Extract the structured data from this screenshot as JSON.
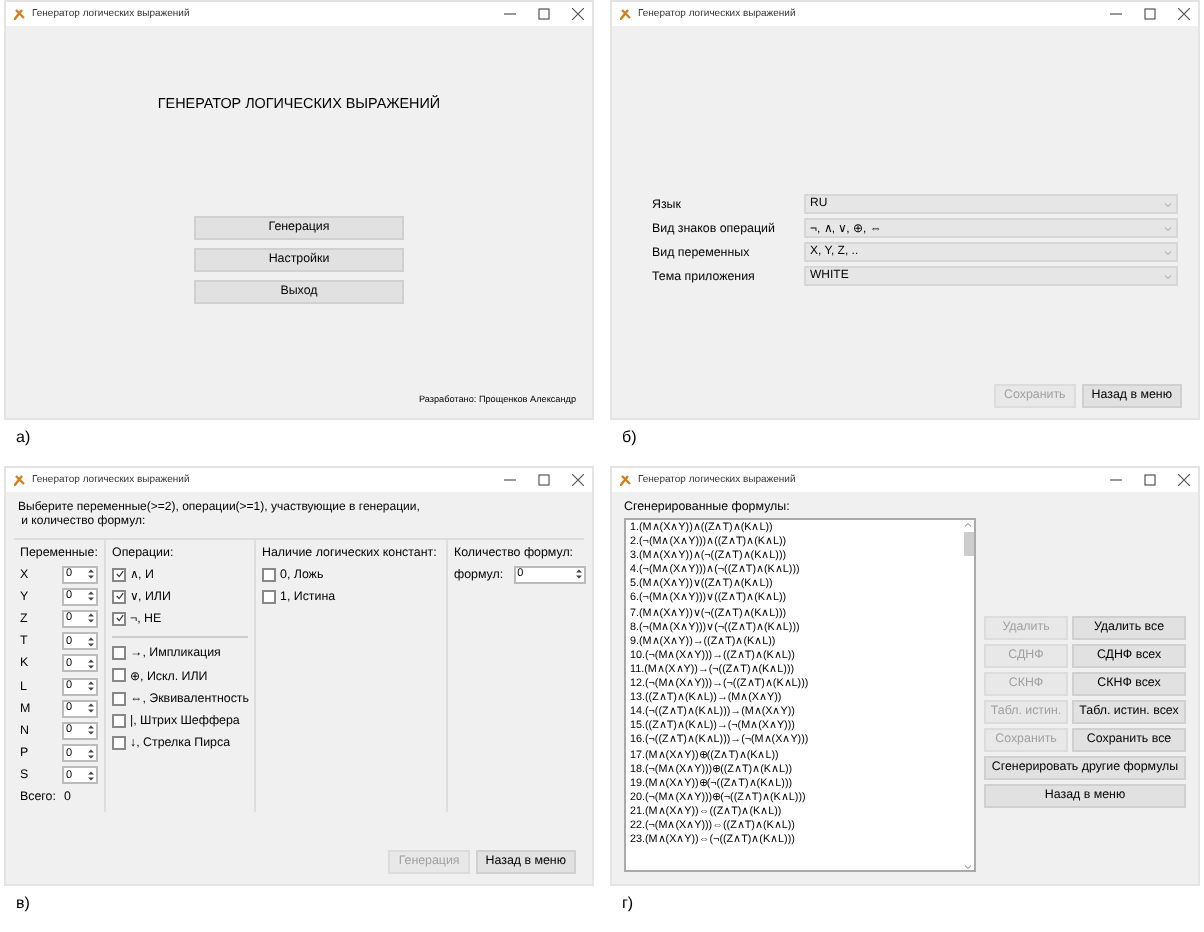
{
  "windows": [
    {
      "kind": "menu",
      "title": "Генератор логических выражений",
      "caption": "а)",
      "heading": "ГЕНЕРАТОР ЛОГИЧЕСКИХ ВЫРАЖЕНИЙ",
      "buttons": [
        {
          "label": "Генерация",
          "disabled": false
        },
        {
          "label": "Настройки",
          "disabled": false
        },
        {
          "label": "Выход",
          "disabled": false
        }
      ],
      "footer": "Разработано: Прощенков Александр"
    },
    {
      "kind": "settings",
      "title": "Генератор логических выражений",
      "caption": "б)",
      "fields": [
        {
          "label": "Язык",
          "value": "RU"
        },
        {
          "label": "Вид знаков операций",
          "value": "¬, ∧, ∨, ⊕, ⇔"
        },
        {
          "label": "Вид переменных",
          "value": "X, Y, Z, .."
        },
        {
          "label": "Тема приложения",
          "value": "WHITE"
        }
      ],
      "buttons": [
        {
          "label": "Сохранить",
          "disabled": true
        },
        {
          "label": "Назад в меню",
          "disabled": false
        }
      ]
    },
    {
      "kind": "generation",
      "title": "Генератор логических выражений",
      "caption": "в)",
      "instruction": "Выберите переменные(>=2), операции(>=1), участвующие в генерации,\n и количество формул:",
      "variables": {
        "header": "Переменные:",
        "items": [
          {
            "name": "X",
            "value": "0"
          },
          {
            "name": "Y",
            "value": "0"
          },
          {
            "name": "Z",
            "value": "0"
          },
          {
            "name": "T",
            "value": "0"
          },
          {
            "name": "K",
            "value": "0"
          },
          {
            "name": "L",
            "value": "0"
          },
          {
            "name": "M",
            "value": "0"
          },
          {
            "name": "N",
            "value": "0"
          },
          {
            "name": "P",
            "value": "0"
          },
          {
            "name": "S",
            "value": "0"
          }
        ],
        "total_label": "Всего:",
        "total": "0"
      },
      "operations": {
        "header": "Операции:",
        "basic": [
          {
            "label": "∧, И",
            "checked": true
          },
          {
            "label": "∨, ИЛИ",
            "checked": true
          },
          {
            "label": "¬, НЕ",
            "checked": true
          }
        ],
        "extra": [
          {
            "label": "→, Импликация",
            "checked": false
          },
          {
            "label": "⊕, Искл. ИЛИ",
            "checked": false
          },
          {
            "label": "⇔, Эквивалентность",
            "checked": false
          },
          {
            "label": "|, Штрих Шеффера",
            "checked": false
          },
          {
            "label": "↓, Стрелка Пирса",
            "checked": false
          }
        ]
      },
      "constants": {
        "header": "Наличие логических констант:",
        "items": [
          {
            "label": "0, Ложь",
            "checked": false
          },
          {
            "label": "1, Истина",
            "checked": false
          }
        ]
      },
      "count": {
        "header": "Количество формул:",
        "label": "формул:",
        "value": "0"
      },
      "buttons": [
        {
          "label": "Генерация",
          "disabled": true
        },
        {
          "label": "Назад в меню",
          "disabled": false
        }
      ]
    },
    {
      "kind": "results",
      "title": "Генератор логических выражений",
      "caption": "г)",
      "list_label": "Сгенерированные формулы:",
      "formulas": [
        "1.(M∧(X∧Y))∧((Z∧T)∧(K∧L))",
        "2.(¬(M∧(X∧Y)))∧((Z∧T)∧(K∧L))",
        "3.(M∧(X∧Y))∧(¬((Z∧T)∧(K∧L)))",
        "4.(¬(M∧(X∧Y)))∧(¬((Z∧T)∧(K∧L)))",
        "5.(M∧(X∧Y))∨((Z∧T)∧(K∧L))",
        "6.(¬(M∧(X∧Y)))∨((Z∧T)∧(K∧L))",
        "7.(M∧(X∧Y))∨(¬((Z∧T)∧(K∧L)))",
        "8.(¬(M∧(X∧Y)))∨(¬((Z∧T)∧(K∧L)))",
        "9.(M∧(X∧Y))→((Z∧T)∧(K∧L))",
        "10.(¬(M∧(X∧Y)))→((Z∧T)∧(K∧L))",
        "11.(M∧(X∧Y))→(¬((Z∧T)∧(K∧L)))",
        "12.(¬(M∧(X∧Y)))→(¬((Z∧T)∧(K∧L)))",
        "13.((Z∧T)∧(K∧L))→(M∧(X∧Y))",
        "14.(¬((Z∧T)∧(K∧L)))→(M∧(X∧Y))",
        "15.((Z∧T)∧(K∧L))→(¬(M∧(X∧Y)))",
        "16.(¬((Z∧T)∧(K∧L)))→(¬(M∧(X∧Y)))",
        "17.(M∧(X∧Y))⊕((Z∧T)∧(K∧L))",
        "18.(¬(M∧(X∧Y)))⊕((Z∧T)∧(K∧L))",
        "19.(M∧(X∧Y))⊕(¬((Z∧T)∧(K∧L)))",
        "20.(¬(M∧(X∧Y)))⊕(¬((Z∧T)∧(K∧L)))",
        "21.(M∧(X∧Y))⇔((Z∧T)∧(K∧L))",
        "22.(¬(M∧(X∧Y)))⇔((Z∧T)∧(K∧L))",
        "23.(M∧(X∧Y))⇔(¬((Z∧T)∧(K∧L)))"
      ],
      "button_pairs": [
        [
          {
            "label": "Удалить",
            "disabled": true
          },
          {
            "label": "Удалить все",
            "disabled": false
          }
        ],
        [
          {
            "label": "СДНФ",
            "disabled": true
          },
          {
            "label": "СДНФ всех",
            "disabled": false
          }
        ],
        [
          {
            "label": "СКНФ",
            "disabled": true
          },
          {
            "label": "СКНФ всех",
            "disabled": false
          }
        ],
        [
          {
            "label": "Табл. истин.",
            "disabled": true
          },
          {
            "label": "Табл. истин. всех",
            "disabled": false
          }
        ],
        [
          {
            "label": "Сохранить",
            "disabled": true
          },
          {
            "label": "Сохранить все",
            "disabled": false
          }
        ]
      ],
      "wide_buttons": [
        {
          "label": "Сгенерировать другие формулы",
          "disabled": false
        },
        {
          "label": "Назад в меню",
          "disabled": false
        }
      ]
    }
  ]
}
